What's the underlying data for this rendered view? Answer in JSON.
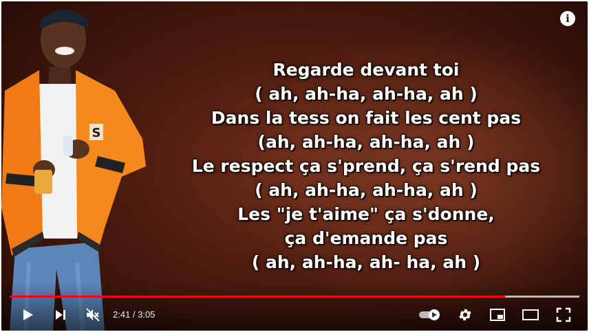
{
  "video": {
    "lyrics": [
      "Regarde devant toi",
      "( ah, ah-ha, ah-ha, ah )",
      "Dans la tess on fait les cent pas",
      "(ah, ah-ha, ah-ha, ah )",
      "Le respect ça s'prend, ça s'rend pas",
      "( ah, ah-ha, ah-ha, ah )",
      "Les \"je t'aime\" ça s'donne,",
      "ça d'emande pas",
      "( ah, ah-ha, ah- ha, ah )"
    ],
    "info_icon": "i"
  },
  "player": {
    "current_time": "2:41",
    "duration": "3:05",
    "time_display": "2:41 / 3:05",
    "played_fraction": 0.87,
    "loaded_fraction": 1.0,
    "muted": true,
    "autoplay_on": true,
    "accent_color": "#ff0000",
    "icons": [
      "play-icon",
      "next-icon",
      "volume-muted-icon",
      "autoplay-toggle-icon",
      "settings-gear-icon",
      "miniplayer-icon",
      "theater-mode-icon",
      "fullscreen-icon"
    ]
  }
}
